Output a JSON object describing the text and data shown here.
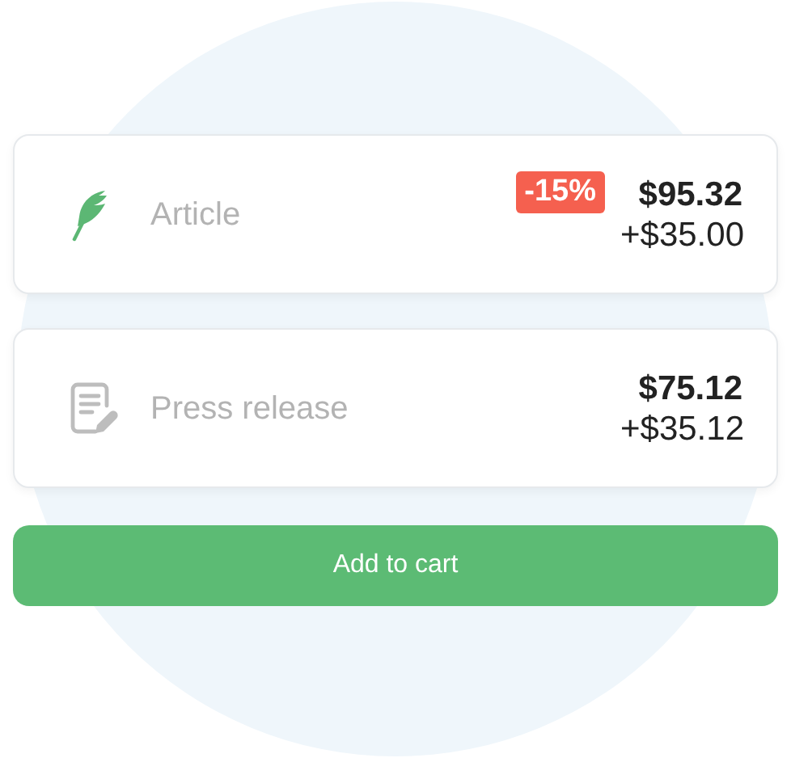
{
  "options": [
    {
      "kind": "feather",
      "label": "Article",
      "selected": true,
      "discount": "-15%",
      "price": "$95.32",
      "extra": "+$35.00"
    },
    {
      "kind": "document",
      "label": "Press release",
      "selected": false,
      "price": "$75.12",
      "extra": "+$35.12"
    }
  ],
  "button": "Add to cart"
}
